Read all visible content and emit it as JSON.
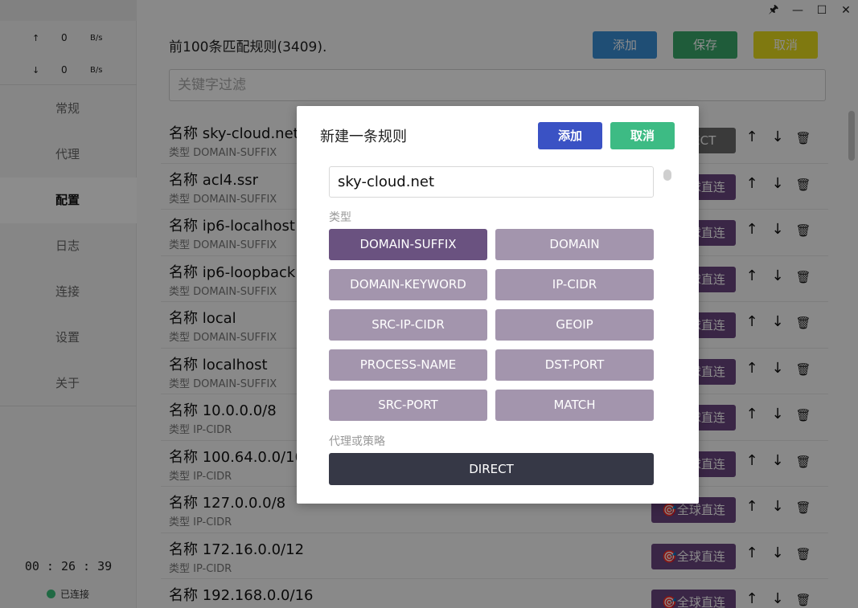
{
  "sidebar": {
    "upload": {
      "arrow": "↑",
      "value": "0",
      "unit": "B/s"
    },
    "download": {
      "arrow": "↓",
      "value": "0",
      "unit": "B/s"
    },
    "nav": [
      "常规",
      "代理",
      "配置",
      "日志",
      "连接",
      "设置",
      "关于"
    ],
    "active_index": 2,
    "timer": "00 : 26 : 39",
    "status": "已连接",
    "status_color": "#3bbf7a"
  },
  "window": {
    "pin": "🖈",
    "minimize": "—",
    "maximize": "☐",
    "close": "✕"
  },
  "main": {
    "title": "前100条匹配规则(3409).",
    "add_label": "添加",
    "save_label": "保存",
    "cancel_label": "取消",
    "filter_placeholder": "关键字过滤",
    "rules": [
      {
        "name": "名称 sky-cloud.net",
        "type": "类型 DOMAIN-SUFFIX",
        "policy": "DIRECT",
        "kind": "direct"
      },
      {
        "name": "名称 acl4.ssr",
        "type": "类型 DOMAIN-SUFFIX",
        "policy": "🎯全球直连",
        "kind": "global"
      },
      {
        "name": "名称 ip6-localhost",
        "type": "类型 DOMAIN-SUFFIX",
        "policy": "🎯全球直连",
        "kind": "global"
      },
      {
        "name": "名称 ip6-loopback",
        "type": "类型 DOMAIN-SUFFIX",
        "policy": "🎯全球直连",
        "kind": "global"
      },
      {
        "name": "名称 local",
        "type": "类型 DOMAIN-SUFFIX",
        "policy": "🎯全球直连",
        "kind": "global"
      },
      {
        "name": "名称 localhost",
        "type": "类型 DOMAIN-SUFFIX",
        "policy": "🎯全球直连",
        "kind": "global"
      },
      {
        "name": "名称 10.0.0.0/8",
        "type": "类型 IP-CIDR",
        "policy": "🎯全球直连",
        "kind": "global"
      },
      {
        "name": "名称 100.64.0.0/10",
        "type": "类型 IP-CIDR",
        "policy": "🎯全球直连",
        "kind": "global"
      },
      {
        "name": "名称 127.0.0.0/8",
        "type": "类型 IP-CIDR",
        "policy": "🎯全球直连",
        "kind": "global"
      },
      {
        "name": "名称 172.16.0.0/12",
        "type": "类型 IP-CIDR",
        "policy": "🎯全球直连",
        "kind": "global"
      },
      {
        "name": "名称 192.168.0.0/16",
        "type": "",
        "policy": "🎯全球直连",
        "kind": "global"
      }
    ],
    "icons": {
      "up": "↑",
      "down": "↓",
      "delete": "🗑"
    }
  },
  "dialog": {
    "title": "新建一条规则",
    "add_label": "添加",
    "cancel_label": "取消",
    "input_value": "sky-cloud.net",
    "type_label": "类型",
    "types": [
      "DOMAIN-SUFFIX",
      "DOMAIN",
      "DOMAIN-KEYWORD",
      "IP-CIDR",
      "SRC-IP-CIDR",
      "GEOIP",
      "PROCESS-NAME",
      "DST-PORT",
      "SRC-PORT",
      "MATCH"
    ],
    "selected_type": "DOMAIN-SUFFIX",
    "policy_label": "代理或策略",
    "policy_value": "DIRECT"
  },
  "colors": {
    "add_blue": "#3a8fd6",
    "save_green": "#3aa86a",
    "cancel_yellow": "#e8dc1e",
    "dialog_add": "#3a52c4",
    "dialog_cancel": "#3dbb84"
  }
}
